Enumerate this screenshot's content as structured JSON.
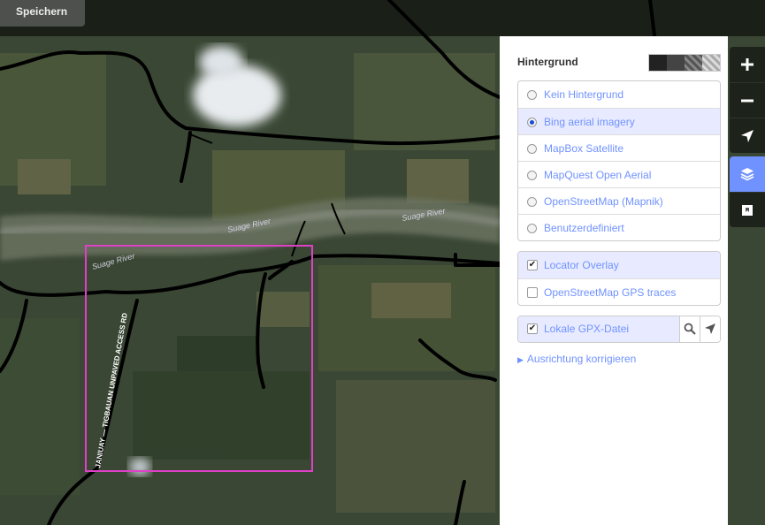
{
  "toolbar": {
    "save_label": "Speichern"
  },
  "map": {
    "road_labels": [
      "Suage River",
      "Suage River",
      "Suage River",
      "JANIUAY — TIGBAUAN UNPAVED ACCESS RD"
    ],
    "selection_color": "#e040c8"
  },
  "background_panel": {
    "title": "Hintergrund",
    "layers": [
      {
        "label": "Kein Hintergrund",
        "selected": false
      },
      {
        "label": "Bing aerial imagery",
        "selected": true
      },
      {
        "label": "MapBox Satellite",
        "selected": false
      },
      {
        "label": "MapQuest Open Aerial",
        "selected": false
      },
      {
        "label": "OpenStreetMap (Mapnik)",
        "selected": false
      },
      {
        "label": "Benutzerdefiniert",
        "selected": false
      }
    ],
    "overlays": [
      {
        "label": "Locator Overlay",
        "checked": true
      },
      {
        "label": "OpenStreetMap GPS traces",
        "checked": false
      }
    ],
    "gpx": {
      "label": "Lokale GPX-Datei",
      "checked": true
    },
    "fix_alignment_label": "Ausrichtung korrigieren"
  },
  "map_controls": {
    "zoom_in": "plus-icon",
    "zoom_out": "minus-icon",
    "geolocate": "location-arrow-icon",
    "background": "layers-icon",
    "help": "map-data-icon"
  },
  "colors": {
    "accent": "#7092ff",
    "active_row": "#e8ebff",
    "control_bg": "rgba(0,0,0,0.5)"
  }
}
